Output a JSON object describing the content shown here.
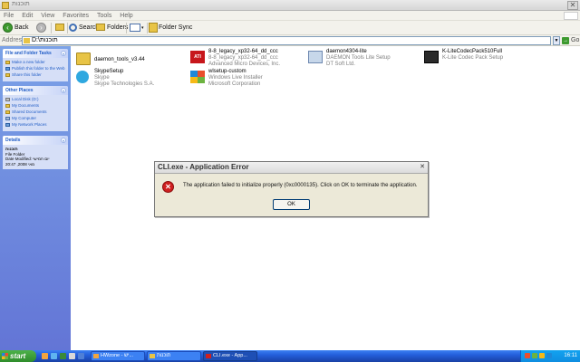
{
  "window": {
    "title": "תוכנות"
  },
  "menu": [
    "File",
    "Edit",
    "View",
    "Favorites",
    "Tools",
    "Help"
  ],
  "toolbar": {
    "back": "Back",
    "search": "Search",
    "folders": "Folders",
    "folder_sync": "Folder Sync"
  },
  "address": {
    "label": "Address",
    "value": "D:\\תוכנות",
    "go": "Go"
  },
  "taskpane": {
    "file_tasks": {
      "title": "File and Folder Tasks",
      "items": [
        "Make a new folder",
        "Publish this folder to the Web",
        "Share this folder"
      ]
    },
    "other_places": {
      "title": "Other Places",
      "items": [
        "Local Disk (D:)",
        "My Documents",
        "Shared Documents",
        "My Computer",
        "My Network Places"
      ]
    },
    "details": {
      "title": "Details",
      "name": "תוכנות",
      "type": "File Folder",
      "modified": "Date Modified: יום חמישי",
      "date": "מאי 2008, 20:47"
    }
  },
  "files": [
    {
      "l1": "daemon_tools_v3.44",
      "l2": "",
      "l3": ""
    },
    {
      "l1": "8-8_legacy_xp32-64_dd_ccc",
      "l2": "8-8_legacy_xp32-64_dd_ccc",
      "l3": "Advanced Micro Devices, Inc."
    },
    {
      "l1": "daemon4304-lite",
      "l2": "DAEMON Tools Lite Setup",
      "l3": "DT Soft Ltd."
    },
    {
      "l1": "K-LiteCodecPack510Full",
      "l2": "K-Lite Codec Pack Setup",
      "l3": ""
    },
    {
      "l1": "SkypeSetup",
      "l2": "Skype",
      "l3": "Skype Technologies S.A."
    },
    {
      "l1": "wlsetup-custom",
      "l2": "Windows Live Installer",
      "l3": "Microsoft Corporation"
    }
  ],
  "dialog": {
    "title": "CLI.exe - Application Error",
    "message": "The application failed to initialize properly (0xc0000135). Click on OK to terminate the application.",
    "ok": "OK"
  },
  "taskbar": {
    "start": "start",
    "tasks": [
      "HWzone - יש...",
      "תוכנות",
      "CLI.exe - App..."
    ],
    "clock": "16:11"
  },
  "colors": {
    "error_red": "#cf2020",
    "taskbar_blue": "#245edb",
    "start_green": "#3c9a33"
  }
}
